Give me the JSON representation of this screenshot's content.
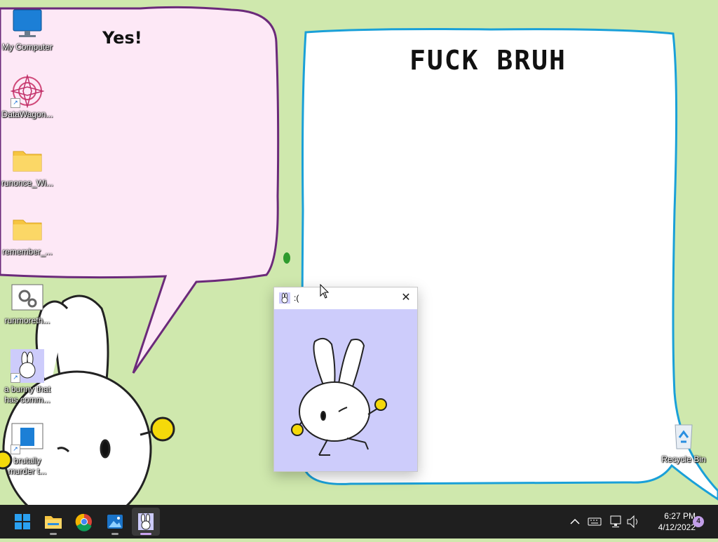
{
  "wallpaper": {
    "left_bubble_text": "Yes!",
    "right_bubble_text": "FUCK BRUH"
  },
  "desktop_icons": [
    {
      "label": "My Computer",
      "icon": "monitor-icon"
    },
    {
      "label": "DataWagon...",
      "icon": "mandala-icon"
    },
    {
      "label": "runonce_Wi...",
      "icon": "folder-icon"
    },
    {
      "label": "remember_...",
      "icon": "folder-icon"
    },
    {
      "label": "runmoreth...",
      "icon": "settings-window-icon"
    },
    {
      "label": "a bunny that has comm...",
      "icon": "bunny-icon"
    },
    {
      "label": "brutally murder t...",
      "icon": "notepad-window-icon"
    }
  ],
  "recycle_bin": {
    "label": "Recycle Bin"
  },
  "popup": {
    "title": ":(",
    "close_glyph": "✕"
  },
  "taskbar": {
    "apps": [
      "start-icon",
      "file-explorer-icon",
      "chrome-icon",
      "photos-icon",
      "bunny-app-icon"
    ],
    "tray_chevron": "^",
    "time": "6:27 PM",
    "date": "4/12/2022",
    "notifications": "4"
  },
  "colors": {
    "wallpaper_bg": "#cfe8ad",
    "left_bubble": "#fde8f6",
    "right_bubble": "#ffffff",
    "popup_bg": "#cdccfb",
    "taskbar": "#1f1f1f",
    "accent_yellow": "#f5d90a"
  }
}
